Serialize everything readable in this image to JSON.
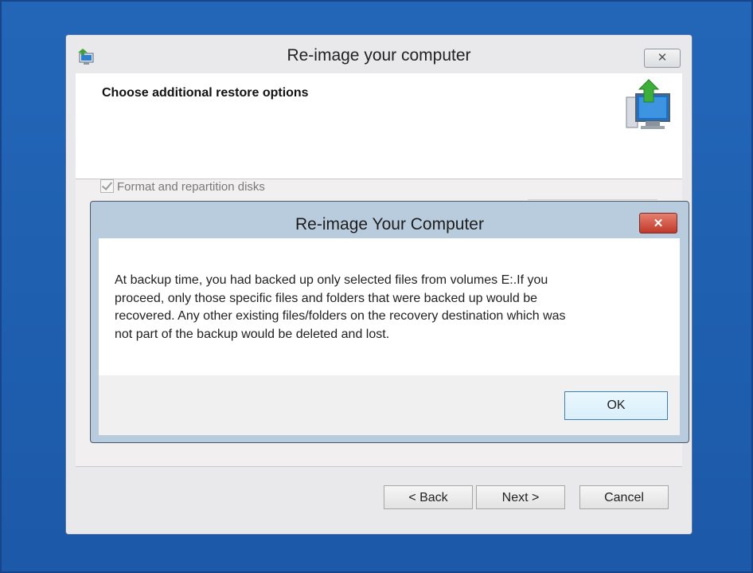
{
  "main_window": {
    "title": "Re-image your computer",
    "close_glyph": "✕",
    "header_title": "Choose additional restore options",
    "format_checkbox": {
      "label": "Format and repartition disks",
      "checked": true,
      "enabled": false
    },
    "buttons": {
      "back": "< Back",
      "next": "Next >",
      "cancel": "Cancel"
    },
    "icons": {
      "app": "backup-restore-icon",
      "header": "computer-restore-icon"
    }
  },
  "dialog": {
    "title": "Re-image Your Computer",
    "close_glyph": "✕",
    "message_lines": [
      "At backup time, you had backed up only selected files from volumes E:.If you",
      "proceed, only those specific files and folders that were backed up would be",
      "recovered. Any other existing files/folders on the recovery destination which was",
      "not part of the backup would be deleted and lost."
    ],
    "ok_label": "OK"
  },
  "colors": {
    "desktop": "#1f5fb0",
    "dialog_close": "#c0392b",
    "ok_border": "#3c7fb1"
  }
}
